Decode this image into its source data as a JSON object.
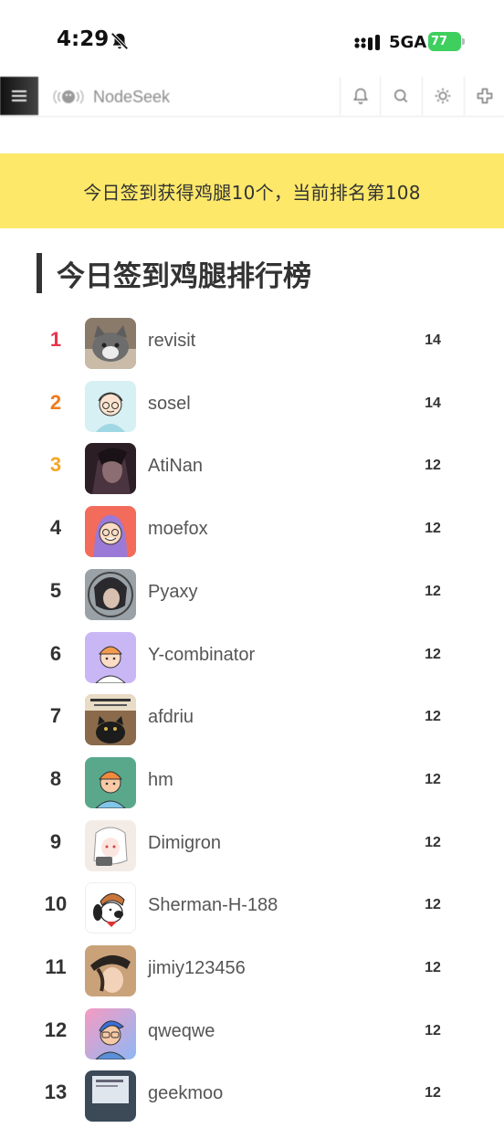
{
  "status_bar": {
    "time": "4:29",
    "network": "5GA",
    "battery": "77"
  },
  "header": {
    "brand": "NodeSeek",
    "icons": [
      "menu-icon",
      "bell-icon",
      "search-icon",
      "sun-icon",
      "plus-icon"
    ]
  },
  "notice": {
    "text": "今日签到获得鸡腿10个，当前排名第108"
  },
  "ranking": {
    "title": "今日签到鸡腿排行榜",
    "rank_colors": {
      "1": "#e8344e",
      "2": "#f07a1a",
      "3": "#f5a623",
      "default": "#333333"
    },
    "rows": [
      {
        "rank": "1",
        "user": "revisit",
        "score": "14"
      },
      {
        "rank": "2",
        "user": "sosel",
        "score": "14"
      },
      {
        "rank": "3",
        "user": "AtiNan",
        "score": "12"
      },
      {
        "rank": "4",
        "user": "moefox",
        "score": "12"
      },
      {
        "rank": "5",
        "user": "Pyaxy",
        "score": "12"
      },
      {
        "rank": "6",
        "user": "Y-combinator",
        "score": "12"
      },
      {
        "rank": "7",
        "user": "afdriu",
        "score": "12"
      },
      {
        "rank": "8",
        "user": "hm",
        "score": "12"
      },
      {
        "rank": "9",
        "user": "Dimigron",
        "score": "12"
      },
      {
        "rank": "10",
        "user": "Sherman-H-188",
        "score": "12"
      },
      {
        "rank": "11",
        "user": "jimiy123456",
        "score": "12"
      },
      {
        "rank": "12",
        "user": "qweqwe",
        "score": "12"
      },
      {
        "rank": "13",
        "user": "geekmoo",
        "score": "12"
      }
    ]
  }
}
